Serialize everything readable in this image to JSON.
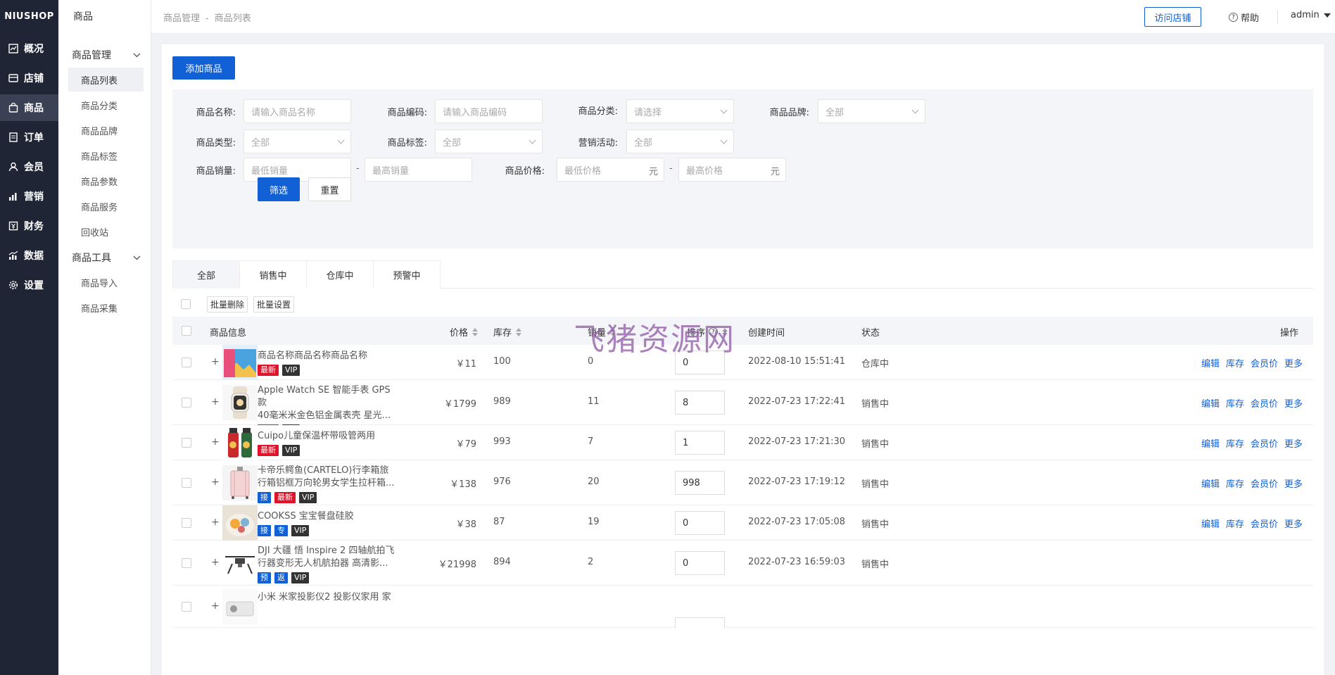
{
  "app": {
    "logo": "NIUSHOP"
  },
  "sidebar": {
    "items": [
      {
        "label": "概况",
        "icon": "chart-icon"
      },
      {
        "label": "店铺",
        "icon": "store-icon"
      },
      {
        "label": "商品",
        "icon": "bag-icon",
        "active": true
      },
      {
        "label": "订单",
        "icon": "document-icon"
      },
      {
        "label": "会员",
        "icon": "user-icon"
      },
      {
        "label": "营销",
        "icon": "bar-chart-icon"
      },
      {
        "label": "财务",
        "icon": "finance-icon"
      },
      {
        "label": "数据",
        "icon": "data-icon"
      },
      {
        "label": "设置",
        "icon": "gear-icon"
      }
    ]
  },
  "submenu": {
    "title": "商品",
    "group1": "商品管理",
    "group1_items": [
      "商品列表",
      "商品分类",
      "商品品牌",
      "商品标签",
      "商品参数",
      "商品服务",
      "回收站"
    ],
    "group2": "商品工具",
    "group2_items": [
      "商品导入",
      "商品采集"
    ]
  },
  "header": {
    "breadcrumb": [
      "商品管理",
      "商品列表"
    ],
    "breadcrumb_sep": "-",
    "visit_store": "访问店铺",
    "help": "帮助",
    "user": "admin"
  },
  "toolbar": {
    "add_goods": "添加商品"
  },
  "filter": {
    "name_label": "商品名称:",
    "name_placeholder": "请输入商品名称",
    "code_label": "商品编码:",
    "code_placeholder": "请输入商品编码",
    "category_label": "商品分类:",
    "category_value": "请选择",
    "brand_label": "商品品牌:",
    "brand_value": "全部",
    "type_label": "商品类型:",
    "type_value": "全部",
    "tag_label": "商品标签:",
    "tag_value": "全部",
    "promo_label": "营销活动:",
    "promo_value": "全部",
    "sales_label": "商品销量:",
    "sales_min": "最低销量",
    "sales_max": "最高销量",
    "price_label": "商品价格:",
    "price_min": "最低价格",
    "price_max": "最高价格",
    "unit": "元",
    "dash": "-",
    "submit": "筛选",
    "reset": "重置"
  },
  "tabs": [
    "全部",
    "销售中",
    "仓库中",
    "预警中"
  ],
  "batch": {
    "delete": "批量删除",
    "settings": "批量设置"
  },
  "table": {
    "headers": {
      "info": "商品信息",
      "price": "价格",
      "stock": "库存",
      "sales": "销量",
      "sort": "排序",
      "created": "创建时间",
      "status": "状态",
      "actions": "操作"
    },
    "ops": [
      "编辑",
      "库存",
      "会员价",
      "更多"
    ],
    "rows": [
      {
        "name1": "商品名称商品名称商品名称",
        "name2": "",
        "tags": [
          [
            "最新",
            "red"
          ],
          [
            "VIP",
            "dark"
          ]
        ],
        "price": "￥11",
        "stock": "100",
        "sales": "0",
        "sort": "0",
        "created": "2022-08-10 15:51:41",
        "status": "仓库中"
      },
      {
        "name1": "Apple Watch SE 智能手表 GPS款",
        "name2": "40毫米米金色铝金属表壳 星光...",
        "tags": [
          [
            "最新",
            "red"
          ],
          [
            "VIP",
            "dark"
          ]
        ],
        "price": "￥1799",
        "stock": "989",
        "sales": "11",
        "sort": "8",
        "created": "2022-07-23 17:22:41",
        "status": "销售中"
      },
      {
        "name1": "Cuipo儿童保温杯带吸管两用",
        "name2": "",
        "tags": [
          [
            "最新",
            "red"
          ],
          [
            "VIP",
            "dark"
          ]
        ],
        "price": "￥79",
        "stock": "993",
        "sales": "7",
        "sort": "1",
        "created": "2022-07-23 17:21:30",
        "status": "销售中"
      },
      {
        "name1": "卡帝乐鳄鱼(CARTELO)行李箱旅",
        "name2": "行箱铝框万向轮男女学生拉杆箱...",
        "tags": [
          [
            "接",
            "blue"
          ],
          [
            "最新",
            "red"
          ],
          [
            "VIP",
            "dark"
          ]
        ],
        "price": "￥138",
        "stock": "976",
        "sales": "20",
        "sort": "998",
        "created": "2022-07-23 17:19:12",
        "status": "销售中"
      },
      {
        "name1": "COOKSS 宝宝餐盘硅胶",
        "name2": "",
        "tags": [
          [
            "接",
            "blue"
          ],
          [
            "专",
            "blue"
          ],
          [
            "VIP",
            "dark"
          ]
        ],
        "price": "￥38",
        "stock": "87",
        "sales": "19",
        "sort": "0",
        "created": "2022-07-23 17:05:08",
        "status": "销售中"
      },
      {
        "name1": "DJI 大疆 悟 Inspire 2 四轴航拍飞",
        "name2": "行器变形无人机航拍器 高清影...",
        "tags": [
          [
            "预",
            "blue"
          ],
          [
            "返",
            "blue"
          ],
          [
            "VIP",
            "dark"
          ]
        ],
        "price": "￥21998",
        "stock": "894",
        "sales": "2",
        "sort": "0",
        "created": "2022-07-23 16:59:03",
        "status": "销售中"
      },
      {
        "name1": "小米 米家投影仪2 投影仪家用 家",
        "name2": "",
        "tags": [],
        "price": "",
        "stock": "",
        "sales": "",
        "sort": "",
        "created": "",
        "status": ""
      }
    ]
  },
  "watermark": "飞猪资源网",
  "colors": {
    "primary": "#1160d5",
    "sidebar_bg": "#1f2535",
    "tag_red": "#e0132b"
  }
}
